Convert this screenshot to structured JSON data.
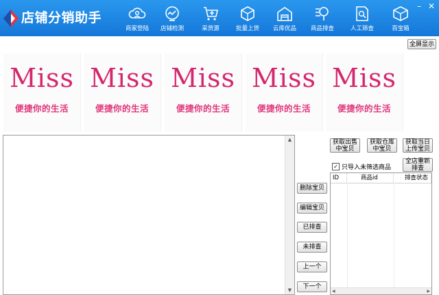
{
  "app": {
    "title": "店铺分销助手"
  },
  "nav": [
    {
      "label": "商家登陆",
      "icon": "cloud-user-icon"
    },
    {
      "label": "店铺检测",
      "icon": "monitor-chart-icon"
    },
    {
      "label": "采货源",
      "icon": "cart-plus-icon"
    },
    {
      "label": "批量上货",
      "icon": "cube-upload-icon"
    },
    {
      "label": "云库优品",
      "icon": "warehouse-icon"
    },
    {
      "label": "商品排查",
      "icon": "magnifier-list-icon"
    },
    {
      "label": "人工筛查",
      "icon": "document-search-icon"
    },
    {
      "label": "百宝箱",
      "icon": "box-icon"
    }
  ],
  "window_controls": {
    "minimize": "–",
    "close": "✕"
  },
  "fullscreen_button": "全屏显示",
  "banners": [
    {
      "brand": "Miss",
      "slogan": "便捷你的生活"
    },
    {
      "brand": "Miss",
      "slogan": "便捷你的生活"
    },
    {
      "brand": "Miss",
      "slogan": "便捷你的生活"
    },
    {
      "brand": "Miss",
      "slogan": "便捷你的生活"
    },
    {
      "brand": "Miss",
      "slogan": "便捷你的生活"
    }
  ],
  "fetch_buttons": {
    "on_sale": "获取出售\n中宝贝",
    "warehouse": "获取仓库\n中宝贝",
    "today": "获取当日\n上传宝贝"
  },
  "checkbox": {
    "label": "只导入未筛选商品",
    "checked": true
  },
  "rescan_button": "全店重新\n排查",
  "side_buttons": {
    "delete": "删除宝贝",
    "edit": "编辑宝贝",
    "checked": "已排查",
    "unchecked": "未排查",
    "prev": "上一个",
    "next": "下一个"
  },
  "table": {
    "columns": [
      "ID",
      "商品id",
      "排查状态"
    ]
  },
  "colors": {
    "title_bar": "#1a86e2",
    "brand_pink": "#d4286e"
  }
}
